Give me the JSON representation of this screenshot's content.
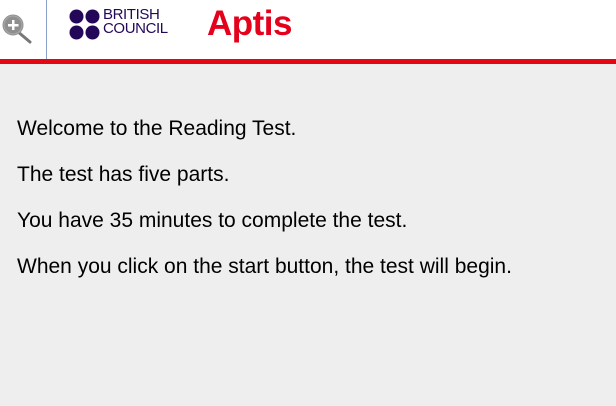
{
  "header": {
    "brand_line1": "BRITISH",
    "brand_line2": "COUNCIL",
    "product_name": "Aptis",
    "icons": {
      "zoom": "zoom-in-icon",
      "logo": "british-council-dots-logo"
    }
  },
  "instructions": {
    "lines": [
      "Welcome to the Reading Test.",
      "The test has five parts.",
      "You have 35 minutes to complete the test.",
      "When you click on the start button, the test will begin."
    ]
  },
  "colors": {
    "brand_red": "#e30613",
    "brand_navy": "#23085a",
    "background": "#eeeeee"
  }
}
